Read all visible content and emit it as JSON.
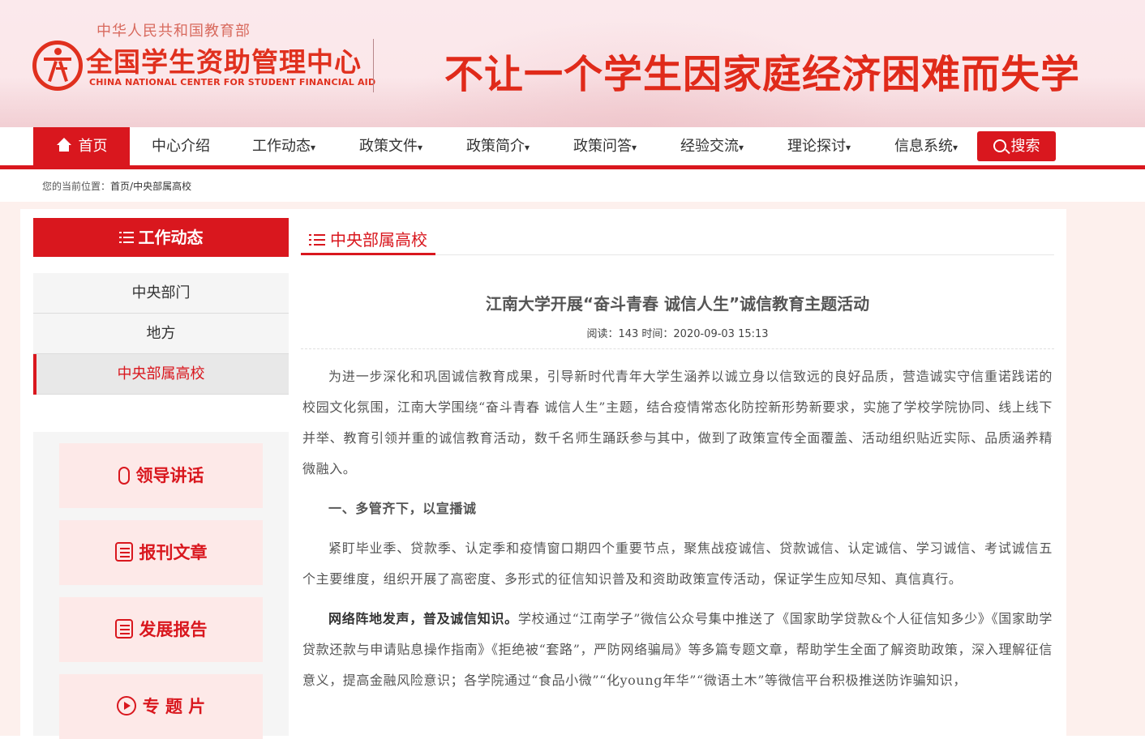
{
  "header": {
    "ministry": "中华人民共和国教育部",
    "org_cn": "全国学生资助管理中心",
    "org_en": "CHINA NATIONAL CENTER FOR STUDENT FINANCIAL AID",
    "slogan": "不让一个学生因家庭经济困难而失学"
  },
  "nav": {
    "home": "首页",
    "items": [
      "中心介绍",
      "工作动态",
      "政策文件",
      "政策简介",
      "政策问答",
      "经验交流",
      "理论探讨",
      "信息系统"
    ],
    "dropdown_marker": "▾",
    "search": "搜索"
  },
  "breadcrumb": {
    "prefix": "您的当前位置：",
    "home": "首页/",
    "current": "中央部属高校"
  },
  "sidebar": {
    "title": "工作动态",
    "items": [
      "中央部门",
      "地方",
      "中央部属高校"
    ],
    "active_index": 2,
    "quick_links": [
      "领导讲话",
      "报刊文章",
      "发展报告",
      "专 题 片"
    ]
  },
  "section": {
    "title": "中央部属高校"
  },
  "article": {
    "title": "江南大学开展“奋斗青春 诚信人生”诚信教育主题活动",
    "meta": "阅读：143 时间：2020-09-03 15:13",
    "p1": "为进一步深化和巩固诚信教育成果，引导新时代青年大学生涵养以诚立身以信致远的良好品质，营造诚实守信重诺践诺的校园文化氛围，江南大学围绕“奋斗青春 诚信人生”主题，结合疫情常态化防控新形势新要求，实施了学校学院协同、线上线下并举、教育引领并重的诚信教育活动，数千名师生踊跃参与其中，做到了政策宣传全面覆盖、活动组织贴近实际、品质涵养精微融入。",
    "h1": "一、多管齐下，以宣播诚",
    "p2": "紧盯毕业季、贷款季、认定季和疫情窗口期四个重要节点，聚焦战疫诚信、贷款诚信、认定诚信、学习诚信、考试诚信五个主要维度，组织开展了高密度、多形式的征信知识普及和资助政策宣传活动，保证学生应知尽知、真信真行。",
    "p3_lead": "网络阵地发声，普及诚信知识。",
    "p3_rest": "学校通过“江南学子”微信公众号集中推送了《国家助学贷款&个人征信知多少》《国家助学贷款还款与申请贴息操作指南》《拒绝被“套路”，严防网络骗局》等多篇专题文章，帮助学生全面了解资助政策，深入理解征信意义，提高金融风险意识；各学院通过“食品小微”“化young年华”“微语土木”等微信平台积极推送防诈骗知识，"
  },
  "colors": {
    "brand_red": "#d9171e",
    "logo_red": "#e0301e",
    "page_bg": "#fdf0ed"
  }
}
